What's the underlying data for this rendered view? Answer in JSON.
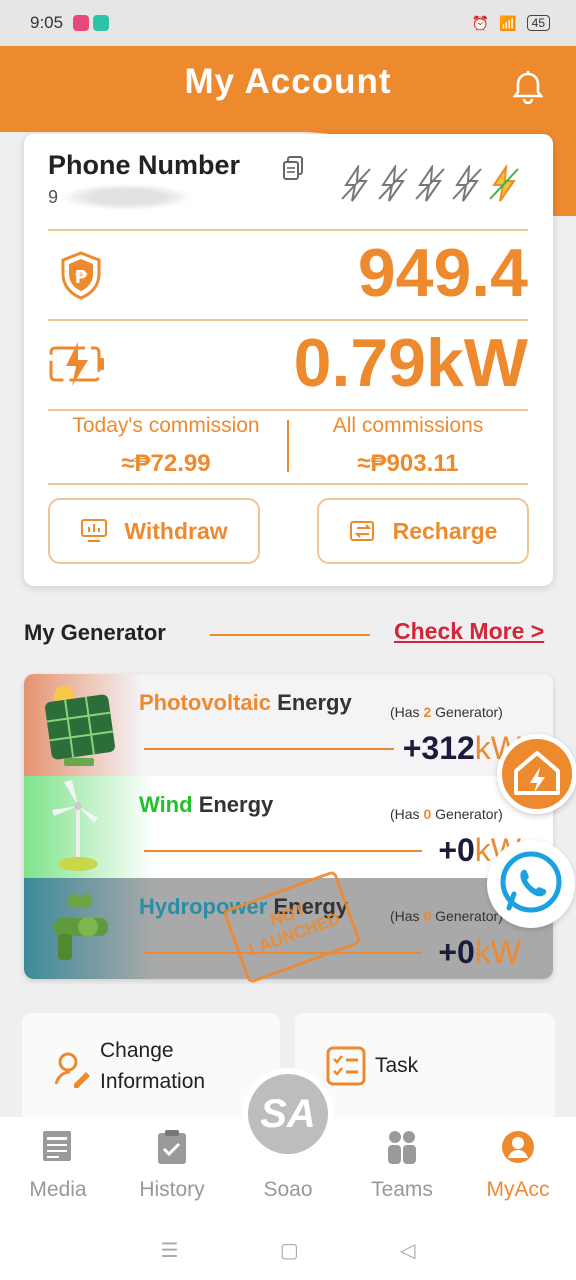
{
  "status_bar": {
    "time": "9:05",
    "battery": "45"
  },
  "header": {
    "title": "My Account"
  },
  "account": {
    "phone_label": "Phone Number",
    "phone_number": "9",
    "balance": "949.4",
    "power": "0.79kW",
    "todays_commission_label": "Today's commission",
    "todays_commission_value": "≈₱72.99",
    "all_commissions_label": "All commissions",
    "all_commissions_value": "≈₱903.11",
    "withdraw_label": "Withdraw",
    "recharge_label": "Recharge"
  },
  "generators": {
    "title": "My Generator",
    "check_more": "Check More >",
    "items": [
      {
        "name": "Photovoltaic",
        "suffix": "Energy",
        "has_prefix": "(Has ",
        "count": "2",
        "has_suffix": " Generator)",
        "value": "+312",
        "unit": "kW",
        "name_color": "#ee8a2e"
      },
      {
        "name": "Wind",
        "suffix": "Energy",
        "has_prefix": "(Has ",
        "count": "0",
        "has_suffix": " Generator)",
        "value": "+0",
        "unit": "kW",
        "name_color": "#22c02a"
      },
      {
        "name": "Hydropower",
        "suffix": "Energy",
        "has_prefix": "(Has ",
        "count": "0",
        "has_suffix": " Generator)",
        "value": "+0",
        "unit": "kW",
        "name_color": "#2b8ea8"
      }
    ],
    "stamp": "NOT LAUNCHED"
  },
  "panels": {
    "change_info": "Change Information",
    "task": "Task"
  },
  "nav": {
    "media": "Media",
    "history": "History",
    "center_label": "Soao",
    "center_logo": "SA",
    "teams": "Teams",
    "myacc": "MyAcc"
  },
  "colors": {
    "accent": "#ee8a2e",
    "check_more": "#d4263a",
    "wind": "#22c02a",
    "hydro": "#2b8ea8"
  }
}
